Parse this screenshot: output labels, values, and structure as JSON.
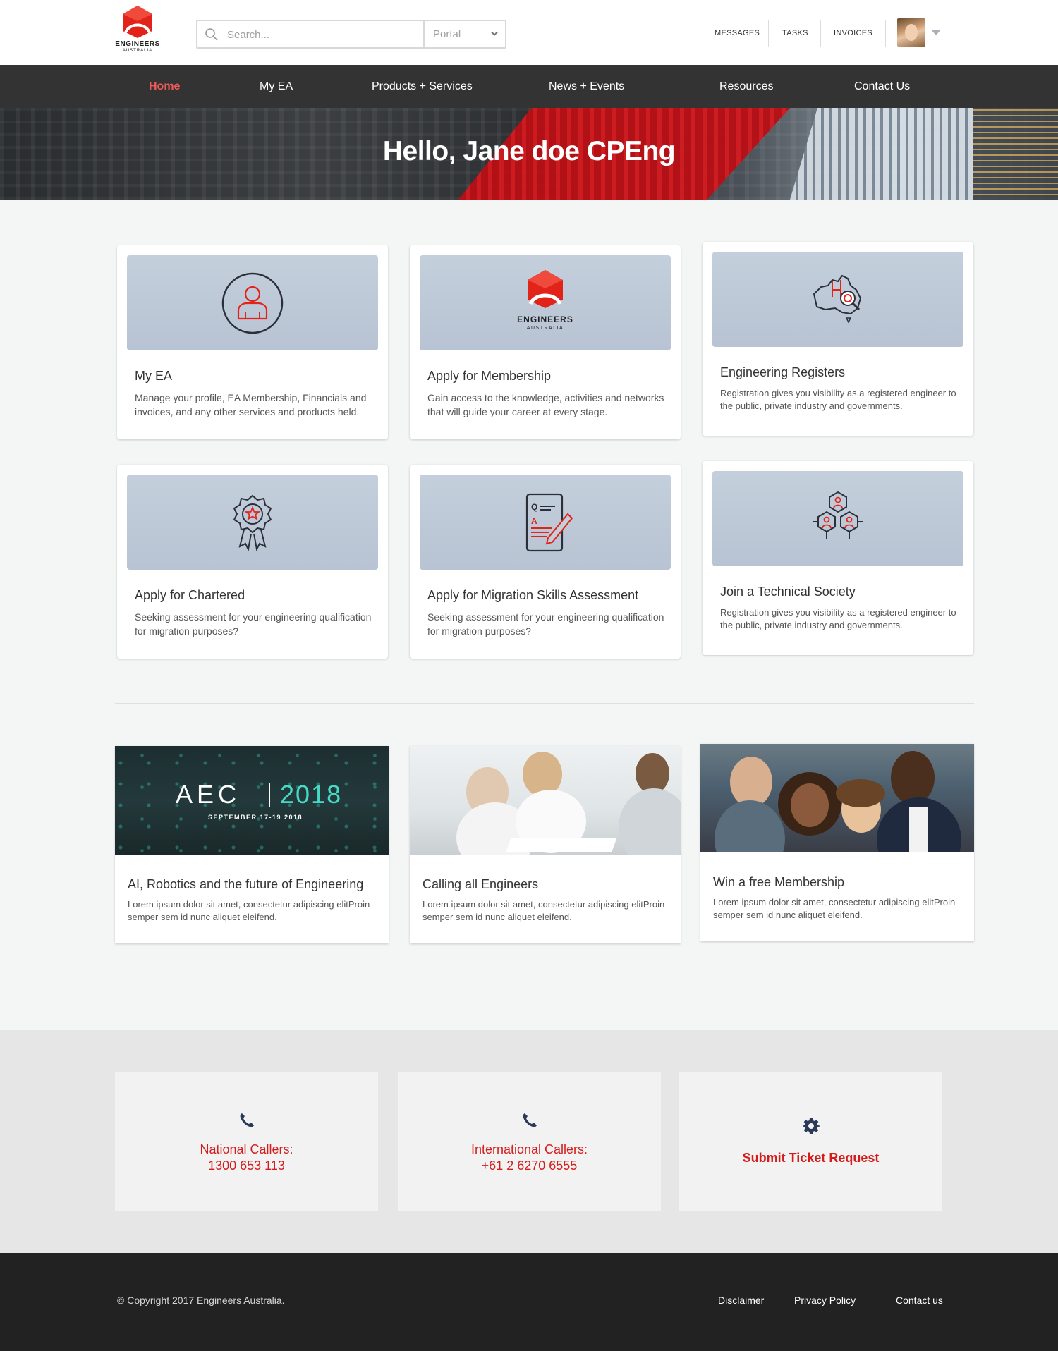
{
  "brand": {
    "line1": "ENGINEERS",
    "line2": "AUSTRALIA",
    "red": "#e2231a"
  },
  "search": {
    "placeholder": "Search...",
    "scope": "Portal"
  },
  "toplinks": [
    "MESSAGES",
    "TASKS",
    "INVOICES"
  ],
  "nav": {
    "items": [
      "Home",
      "My EA",
      "Products + Services",
      "News + Events",
      "Resources",
      "Contact Us"
    ],
    "active": "Home"
  },
  "hero": {
    "greeting": "Hello, Jane doe CPEng"
  },
  "cards": [
    {
      "title": "My EA",
      "desc": "Manage your profile, EA Membership, Financials and invoices, and any other services and products held.",
      "icon": "user-circle-icon"
    },
    {
      "title": "Apply for Membership",
      "desc": "Gain access to the knowledge, activities and networks that will guide your career at every stage.",
      "icon": "ea-logo-icon"
    },
    {
      "title": "Engineering Registers",
      "desc": "Registration gives you visibility as a registered engineer to the public, private industry and governments.",
      "icon": "australia-map-search-icon"
    },
    {
      "title": "Apply for Chartered",
      "desc": "Seeking assessment for your engineering qualification for migration purposes?",
      "icon": "award-badge-icon"
    },
    {
      "title": "Apply for Migration Skills Assessment",
      "desc": "Seeking assessment for your engineering qualification for migration purposes?",
      "icon": "qa-document-icon"
    },
    {
      "title": "Join a Technical Society",
      "desc": "Registration gives you visibility as a registered engineer to the public, private industry and governments.",
      "icon": "network-hexagon-icon"
    }
  ],
  "news": [
    {
      "title": "AI, Robotics and the future of Engineering",
      "desc": "Lorem ipsum dolor sit amet, consectetur adipiscing elitProin semper sem id nunc aliquet eleifend.",
      "banner": {
        "word": "AEC",
        "year": "2018",
        "date": "SEPTEMBER 17-19 2018"
      }
    },
    {
      "title": "Calling all Engineers",
      "desc": "Lorem ipsum dolor sit amet, consectetur adipiscing elitProin semper sem id nunc aliquet eleifend."
    },
    {
      "title": "Win a free Membership",
      "desc": "Lorem ipsum dolor sit amet, consectetur adipiscing elitProin semper sem id nunc aliquet eleifend."
    }
  ],
  "support": {
    "national": {
      "label": "National Callers:",
      "number": "1300 653 113"
    },
    "international": {
      "label": "International Callers:",
      "number": "+61 2 6270 6555"
    },
    "ticket": {
      "label": "Submit Ticket Request"
    }
  },
  "footer": {
    "copyright": "© Copyright 2017 Engineers Australia.",
    "links": [
      "Disclaimer",
      "Privacy Policy",
      "Contact us"
    ]
  }
}
